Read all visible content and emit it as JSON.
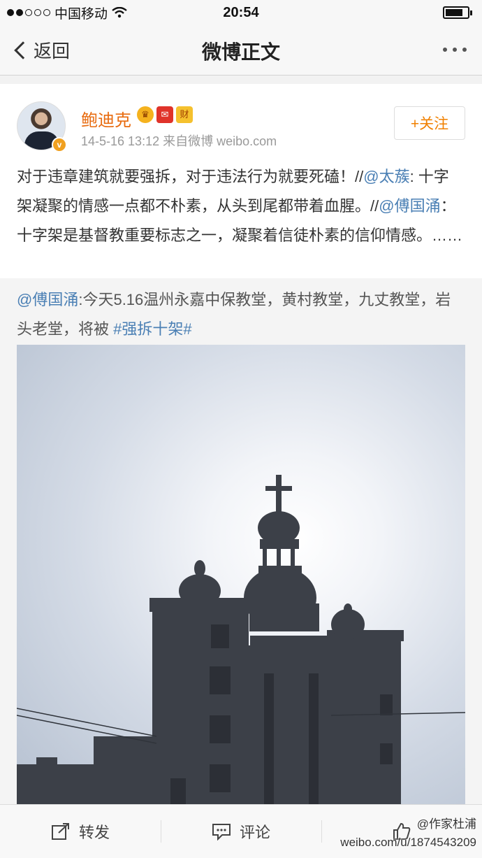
{
  "status_bar": {
    "carrier": "中国移动",
    "time": "20:54",
    "battery_level": 0.8
  },
  "nav": {
    "back_label": "返回",
    "title": "微博正文"
  },
  "post": {
    "author": "鲍迪克",
    "badges": [
      "财"
    ],
    "time": "14-5-16 13:12",
    "source": "来自微博 weibo.com",
    "follow_label": "+关注",
    "text_segments": [
      {
        "text": "对于违章建筑就要强拆，对于违法行为就要死磕！//",
        "link": false
      },
      {
        "text": "@太蔟",
        "link": true
      },
      {
        "text": ": 十字架凝聚的情感一点都不朴素，从头到尾都带着血腥。//",
        "link": false
      },
      {
        "text": "@傅国涌",
        "link": true
      },
      {
        "text": "：十字架是基督教重要标志之一，凝聚着信徒朴素的信仰情感。……",
        "link": false
      }
    ]
  },
  "repost": {
    "segments": [
      {
        "text": "@傅国涌",
        "link": true
      },
      {
        "text": ":今天5.16温州永嘉中保教堂，黄村教堂，九丈教堂，岩头老堂，将被 ",
        "link": false
      },
      {
        "text": "#强拆十架#",
        "link": true
      }
    ]
  },
  "toolbar": {
    "repost_label": "转发",
    "comment_label": "评论"
  },
  "watermark": {
    "line1": "@作家杜浦",
    "line2": "weibo.com/u/1874543209"
  },
  "colors": {
    "accent_orange": "#e86b0f",
    "link_blue": "#4a7fb4",
    "follow_orange": "#f08000"
  },
  "icons": [
    "chevron-left-icon",
    "more-icon",
    "verified-icon",
    "share-icon",
    "comment-icon"
  ]
}
